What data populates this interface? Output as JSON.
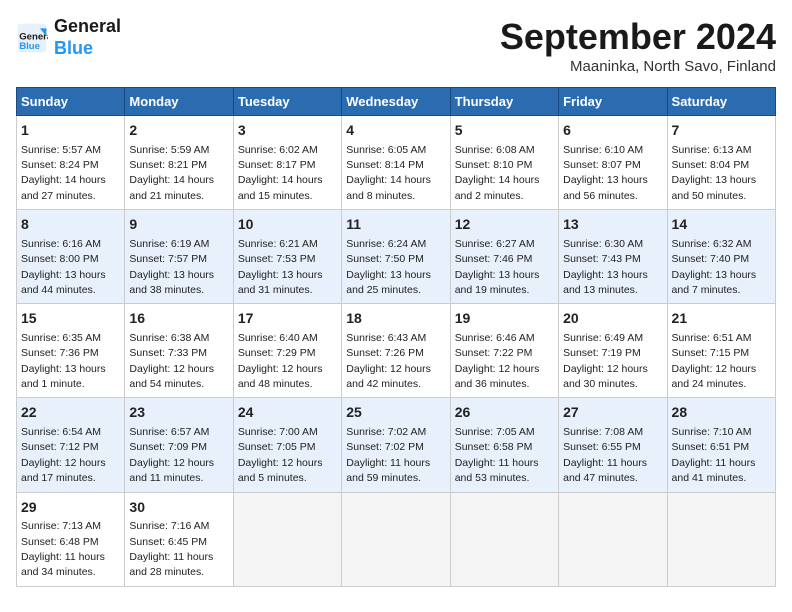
{
  "header": {
    "logo_line1": "General",
    "logo_line2": "Blue",
    "month": "September 2024",
    "location": "Maaninka, North Savo, Finland"
  },
  "columns": [
    "Sunday",
    "Monday",
    "Tuesday",
    "Wednesday",
    "Thursday",
    "Friday",
    "Saturday"
  ],
  "weeks": [
    [
      {
        "day": "1",
        "info": "Sunrise: 5:57 AM\nSunset: 8:24 PM\nDaylight: 14 hours\nand 27 minutes."
      },
      {
        "day": "2",
        "info": "Sunrise: 5:59 AM\nSunset: 8:21 PM\nDaylight: 14 hours\nand 21 minutes."
      },
      {
        "day": "3",
        "info": "Sunrise: 6:02 AM\nSunset: 8:17 PM\nDaylight: 14 hours\nand 15 minutes."
      },
      {
        "day": "4",
        "info": "Sunrise: 6:05 AM\nSunset: 8:14 PM\nDaylight: 14 hours\nand 8 minutes."
      },
      {
        "day": "5",
        "info": "Sunrise: 6:08 AM\nSunset: 8:10 PM\nDaylight: 14 hours\nand 2 minutes."
      },
      {
        "day": "6",
        "info": "Sunrise: 6:10 AM\nSunset: 8:07 PM\nDaylight: 13 hours\nand 56 minutes."
      },
      {
        "day": "7",
        "info": "Sunrise: 6:13 AM\nSunset: 8:04 PM\nDaylight: 13 hours\nand 50 minutes."
      }
    ],
    [
      {
        "day": "8",
        "info": "Sunrise: 6:16 AM\nSunset: 8:00 PM\nDaylight: 13 hours\nand 44 minutes."
      },
      {
        "day": "9",
        "info": "Sunrise: 6:19 AM\nSunset: 7:57 PM\nDaylight: 13 hours\nand 38 minutes."
      },
      {
        "day": "10",
        "info": "Sunrise: 6:21 AM\nSunset: 7:53 PM\nDaylight: 13 hours\nand 31 minutes."
      },
      {
        "day": "11",
        "info": "Sunrise: 6:24 AM\nSunset: 7:50 PM\nDaylight: 13 hours\nand 25 minutes."
      },
      {
        "day": "12",
        "info": "Sunrise: 6:27 AM\nSunset: 7:46 PM\nDaylight: 13 hours\nand 19 minutes."
      },
      {
        "day": "13",
        "info": "Sunrise: 6:30 AM\nSunset: 7:43 PM\nDaylight: 13 hours\nand 13 minutes."
      },
      {
        "day": "14",
        "info": "Sunrise: 6:32 AM\nSunset: 7:40 PM\nDaylight: 13 hours\nand 7 minutes."
      }
    ],
    [
      {
        "day": "15",
        "info": "Sunrise: 6:35 AM\nSunset: 7:36 PM\nDaylight: 13 hours\nand 1 minute."
      },
      {
        "day": "16",
        "info": "Sunrise: 6:38 AM\nSunset: 7:33 PM\nDaylight: 12 hours\nand 54 minutes."
      },
      {
        "day": "17",
        "info": "Sunrise: 6:40 AM\nSunset: 7:29 PM\nDaylight: 12 hours\nand 48 minutes."
      },
      {
        "day": "18",
        "info": "Sunrise: 6:43 AM\nSunset: 7:26 PM\nDaylight: 12 hours\nand 42 minutes."
      },
      {
        "day": "19",
        "info": "Sunrise: 6:46 AM\nSunset: 7:22 PM\nDaylight: 12 hours\nand 36 minutes."
      },
      {
        "day": "20",
        "info": "Sunrise: 6:49 AM\nSunset: 7:19 PM\nDaylight: 12 hours\nand 30 minutes."
      },
      {
        "day": "21",
        "info": "Sunrise: 6:51 AM\nSunset: 7:15 PM\nDaylight: 12 hours\nand 24 minutes."
      }
    ],
    [
      {
        "day": "22",
        "info": "Sunrise: 6:54 AM\nSunset: 7:12 PM\nDaylight: 12 hours\nand 17 minutes."
      },
      {
        "day": "23",
        "info": "Sunrise: 6:57 AM\nSunset: 7:09 PM\nDaylight: 12 hours\nand 11 minutes."
      },
      {
        "day": "24",
        "info": "Sunrise: 7:00 AM\nSunset: 7:05 PM\nDaylight: 12 hours\nand 5 minutes."
      },
      {
        "day": "25",
        "info": "Sunrise: 7:02 AM\nSunset: 7:02 PM\nDaylight: 11 hours\nand 59 minutes."
      },
      {
        "day": "26",
        "info": "Sunrise: 7:05 AM\nSunset: 6:58 PM\nDaylight: 11 hours\nand 53 minutes."
      },
      {
        "day": "27",
        "info": "Sunrise: 7:08 AM\nSunset: 6:55 PM\nDaylight: 11 hours\nand 47 minutes."
      },
      {
        "day": "28",
        "info": "Sunrise: 7:10 AM\nSunset: 6:51 PM\nDaylight: 11 hours\nand 41 minutes."
      }
    ],
    [
      {
        "day": "29",
        "info": "Sunrise: 7:13 AM\nSunset: 6:48 PM\nDaylight: 11 hours\nand 34 minutes."
      },
      {
        "day": "30",
        "info": "Sunrise: 7:16 AM\nSunset: 6:45 PM\nDaylight: 11 hours\nand 28 minutes."
      },
      {
        "day": "",
        "info": ""
      },
      {
        "day": "",
        "info": ""
      },
      {
        "day": "",
        "info": ""
      },
      {
        "day": "",
        "info": ""
      },
      {
        "day": "",
        "info": ""
      }
    ]
  ]
}
